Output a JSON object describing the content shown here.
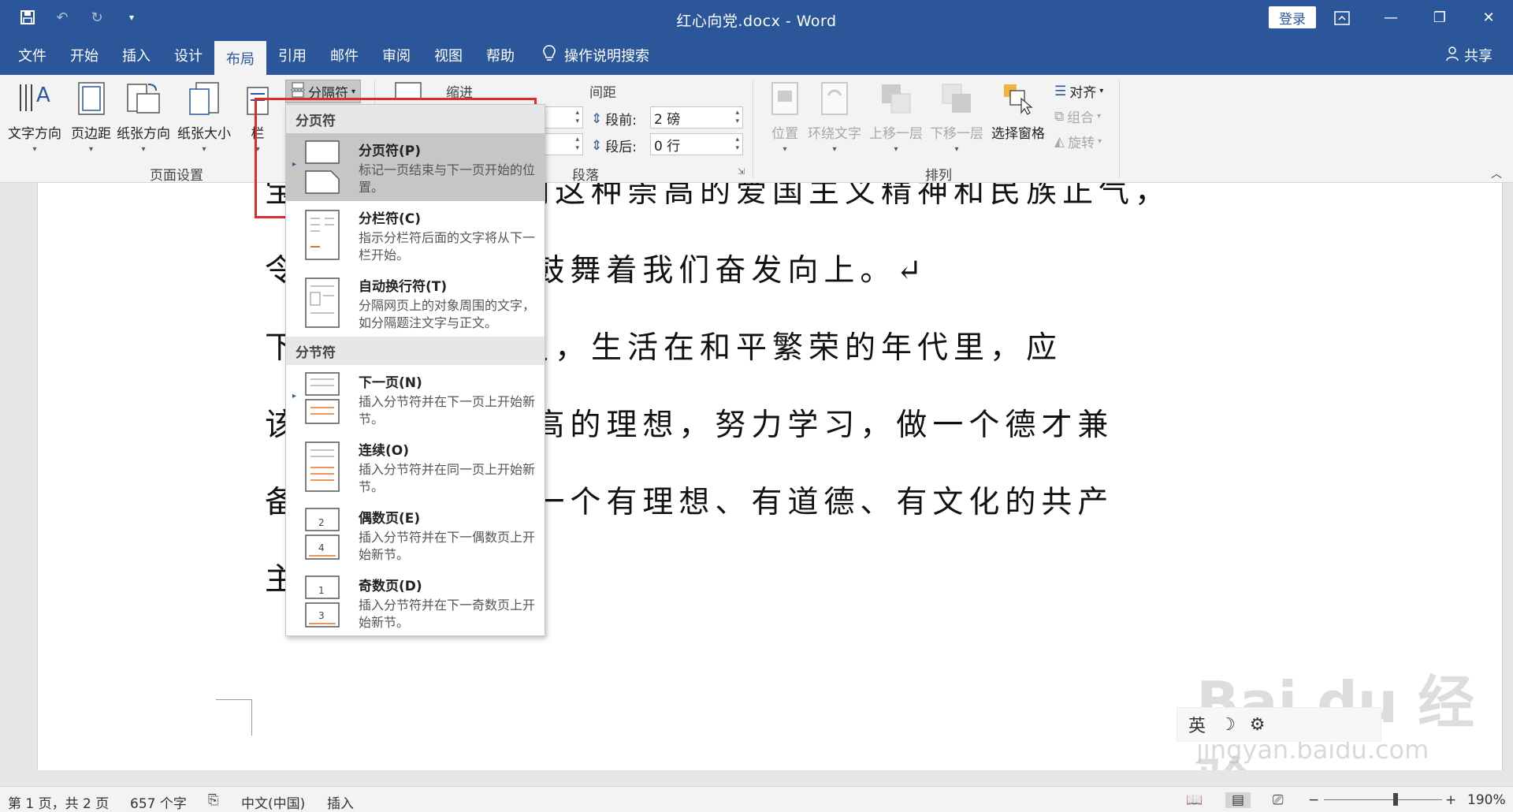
{
  "window": {
    "title": "红心向党.docx  -  Word",
    "login_label": "登录",
    "share_label": "共享"
  },
  "tabs": [
    "文件",
    "开始",
    "插入",
    "设计",
    "布局",
    "引用",
    "邮件",
    "审阅",
    "视图",
    "帮助"
  ],
  "active_tab": "布局",
  "tell_me": "操作说明搜索",
  "ribbon": {
    "page_setup": {
      "label": "页面设置",
      "text_direction": "文字方向",
      "margins": "页边距",
      "orientation": "纸张方向",
      "size": "纸张大小",
      "columns": "栏",
      "breaks": "分隔符"
    },
    "indent_label": "缩进",
    "spacing_label": "间距",
    "before_label": "段前:",
    "before_value": "2 磅",
    "after_label": "段后:",
    "after_value": "0 行",
    "paragraph_label": "段落",
    "arrange": {
      "label": "排列",
      "position": "位置",
      "wrap": "环绕文字",
      "forward": "上移一层",
      "backward": "下移一层",
      "selection_pane": "选择窗格",
      "align": "对齐",
      "group": "组合",
      "rotate": "旋转"
    }
  },
  "dropdown": {
    "section1": "分页符",
    "section2": "分节符",
    "items": [
      {
        "title": "分页符(P)",
        "desc": "标记一页结束与下一页开始的位置。"
      },
      {
        "title": "分栏符(C)",
        "desc": "指示分栏符后面的文字将从下一栏开始。"
      },
      {
        "title": "自动换行符(T)",
        "desc": "分隔网页上的对象周围的文字，如分隔题注文字与正文。"
      },
      {
        "title": "下一页(N)",
        "desc": "插入分节符并在下一页上开始新节。"
      },
      {
        "title": "连续(O)",
        "desc": "插入分节符并在同一页上开始新节。"
      },
      {
        "title": "偶数页(E)",
        "desc": "插入分节符并在下一偶数页上开始新节。"
      },
      {
        "title": "奇数页(D)",
        "desc": "插入分节符并在下一奇数页上开始新节。"
      }
    ]
  },
  "document": {
    "lines": [
      "宝贵的生命，他们这种崇高的爱国主义精神和民族正气，",
      "令              们的精神永远鼓舞着我们奋发向上。↵",
      "                下的中国少先队员，生活在和平繁荣的年代里，应",
      "该              致敬，心怀崇高的理想，努力学习，做一个德才兼",
      "备              力使自己成为一个有理想、有道德、有文化的共产",
      "主"
    ]
  },
  "ime": [
    "英",
    "☽",
    "⚙"
  ],
  "watermark": {
    "main": "Bai du 经验",
    "sub": "jingyan.baidu.com"
  },
  "status": {
    "page": "第 1 页，共 2 页",
    "words": "657 个字",
    "language": "中文(中国)",
    "mode": "插入",
    "zoom": "190%"
  },
  "colors": {
    "accent": "#2b579a",
    "highlight": "#e02b2b"
  }
}
